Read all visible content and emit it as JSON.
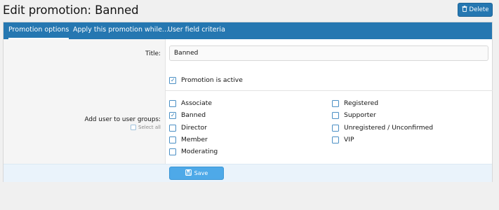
{
  "header": {
    "title": "Edit promotion: Banned",
    "delete_label": "Delete"
  },
  "tabs": [
    {
      "label": "Promotion options",
      "active": true
    },
    {
      "label": "Apply this promotion while...",
      "active": false
    },
    {
      "label": "User field criteria",
      "active": false
    }
  ],
  "form": {
    "title_label": "Title:",
    "title_value": "Banned",
    "active_label": "Promotion is active",
    "active_checked": true,
    "groups_label": "Add user to user groups:",
    "select_all_label": "Select all",
    "groups_col1": [
      {
        "label": "Associate",
        "checked": false
      },
      {
        "label": "Banned",
        "checked": true
      },
      {
        "label": "Director",
        "checked": false
      },
      {
        "label": "Member",
        "checked": false
      },
      {
        "label": "Moderating",
        "checked": false
      }
    ],
    "groups_col2": [
      {
        "label": "Registered",
        "checked": false
      },
      {
        "label": "Supporter",
        "checked": false
      },
      {
        "label": "Unregistered / Unconfirmed",
        "checked": false
      },
      {
        "label": "VIP",
        "checked": false
      }
    ],
    "save_label": "Save"
  },
  "icons": {
    "delete": "trash-icon",
    "save": "save-icon",
    "check": "checkmark-icon"
  },
  "colors": {
    "accent": "#2577b1",
    "save_button": "#4ea9e8",
    "footer": "#eaf3fb"
  }
}
